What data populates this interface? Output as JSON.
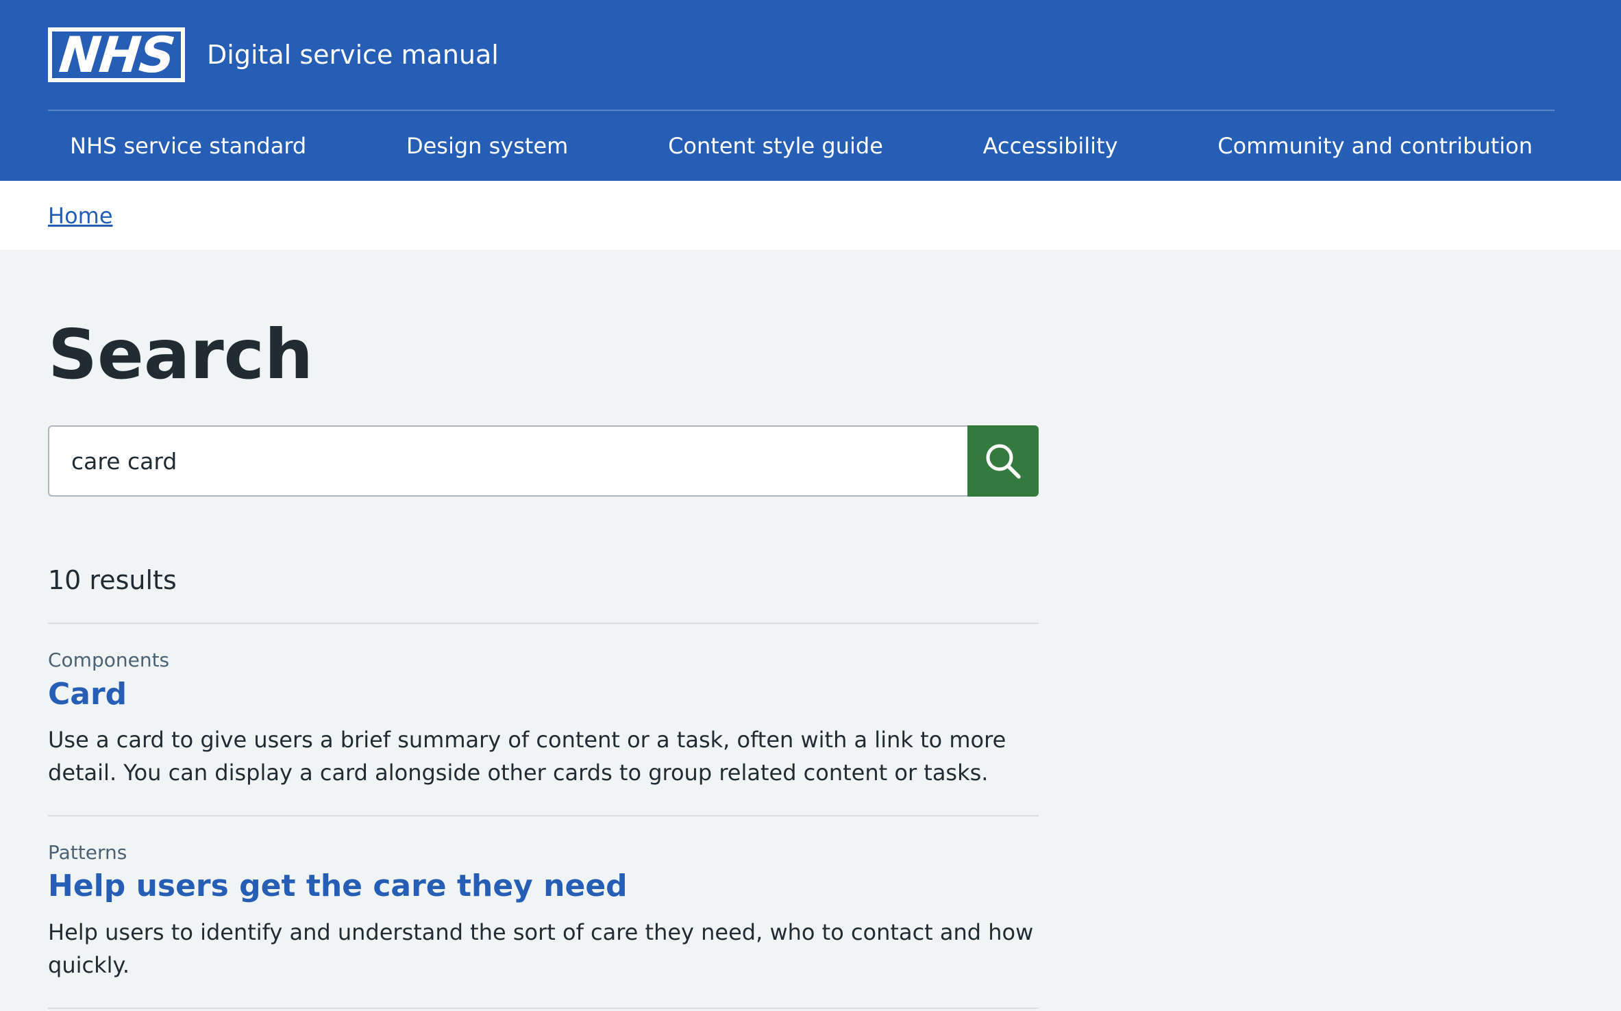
{
  "header": {
    "logo_text": "NHS",
    "service_name": "Digital service manual",
    "nav": [
      {
        "label": "NHS service standard"
      },
      {
        "label": "Design system"
      },
      {
        "label": "Content style guide"
      },
      {
        "label": "Accessibility"
      },
      {
        "label": "Community and contribution"
      }
    ]
  },
  "breadcrumb": {
    "home": "Home"
  },
  "main": {
    "title": "Search",
    "search": {
      "value": "care card",
      "button_icon": "search-icon"
    },
    "results_count": "10 results",
    "results": [
      {
        "category": "Components",
        "title": "Card",
        "description": "Use a card to give users a brief summary of content or a task, often with a link to more detail. You can display a card alongside other cards to group related content or tasks."
      },
      {
        "category": "Patterns",
        "title": "Help users get the care they need",
        "description": "Help users to identify and understand the sort of care they need, who to contact and how quickly."
      }
    ]
  },
  "colors": {
    "header_blue": "#255eb4",
    "search_green": "#347a3e",
    "page_background": "#f0f4f5",
    "link": "#255eb4",
    "text": "#212b32"
  }
}
